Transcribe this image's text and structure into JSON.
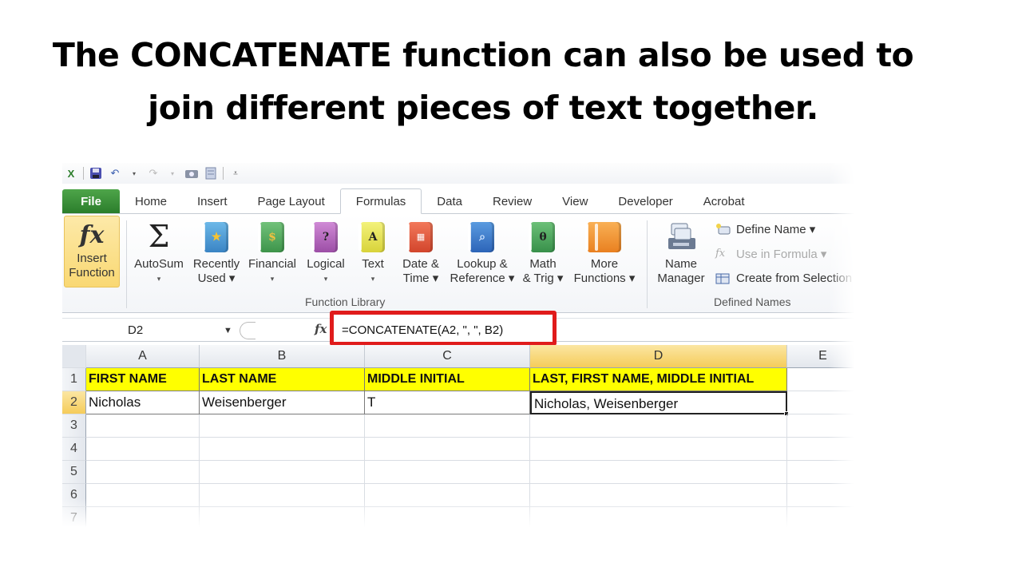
{
  "slide": {
    "title_line1": "The CONCATENATE function can also be used to",
    "title_line2": "join different pieces of text together."
  },
  "quick_access": {
    "icons": [
      "excel-icon",
      "save-icon",
      "undo-icon",
      "redo-icon",
      "camera-icon",
      "form-icon",
      "customize-qat-icon"
    ]
  },
  "tabs": [
    {
      "label": "File"
    },
    {
      "label": "Home"
    },
    {
      "label": "Insert"
    },
    {
      "label": "Page Layout"
    },
    {
      "label": "Formulas",
      "active": true
    },
    {
      "label": "Data"
    },
    {
      "label": "Review"
    },
    {
      "label": "View"
    },
    {
      "label": "Developer"
    },
    {
      "label": "Acrobat"
    }
  ],
  "ribbon": {
    "function_library": {
      "group_label": "Function Library",
      "insert_function": {
        "line1": "Insert",
        "line2": "Function"
      },
      "autosum": {
        "line1": "AutoSum",
        "line2": "▾"
      },
      "recently_used": {
        "line1": "Recently",
        "line2": "Used ▾"
      },
      "financial": {
        "line1": "Financial",
        "line2": "▾"
      },
      "logical": {
        "line1": "Logical",
        "line2": "▾"
      },
      "text": {
        "line1": "Text",
        "line2": "▾"
      },
      "date_time": {
        "line1": "Date &",
        "line2": "Time ▾"
      },
      "lookup_reference": {
        "line1": "Lookup &",
        "line2": "Reference ▾"
      },
      "math_trig": {
        "line1": "Math",
        "line2": "& Trig ▾"
      },
      "more_functions": {
        "line1": "More",
        "line2": "Functions ▾"
      }
    },
    "defined_names": {
      "group_label": "Defined Names",
      "name_manager": {
        "line1": "Name",
        "line2": "Manager"
      },
      "define_name": "Define Name ▾",
      "use_in_formula": "Use in Formula ▾",
      "create_from_selection": "Create from Selection"
    }
  },
  "formula_bar": {
    "name_box": "D2",
    "fx_label": "fx",
    "formula": "=CONCATENATE(A2, \", \", B2)"
  },
  "sheet": {
    "columns": [
      "A",
      "B",
      "C",
      "D",
      "E"
    ],
    "selected_column": "D",
    "rows": [
      "1",
      "2",
      "3",
      "4",
      "5",
      "6",
      "7"
    ],
    "selected_row": "2",
    "header_row": [
      "FIRST NAME",
      "LAST NAME",
      "MIDDLE INITIAL",
      "LAST, FIRST NAME, MIDDLE INITIAL"
    ],
    "data_row": [
      "Nicholas",
      "Weisenberger",
      "T",
      "Nicholas, Weisenberger"
    ],
    "active_cell": "D2",
    "header_fill_color": "#ffff00",
    "highlight_color": "#e01b1b"
  }
}
